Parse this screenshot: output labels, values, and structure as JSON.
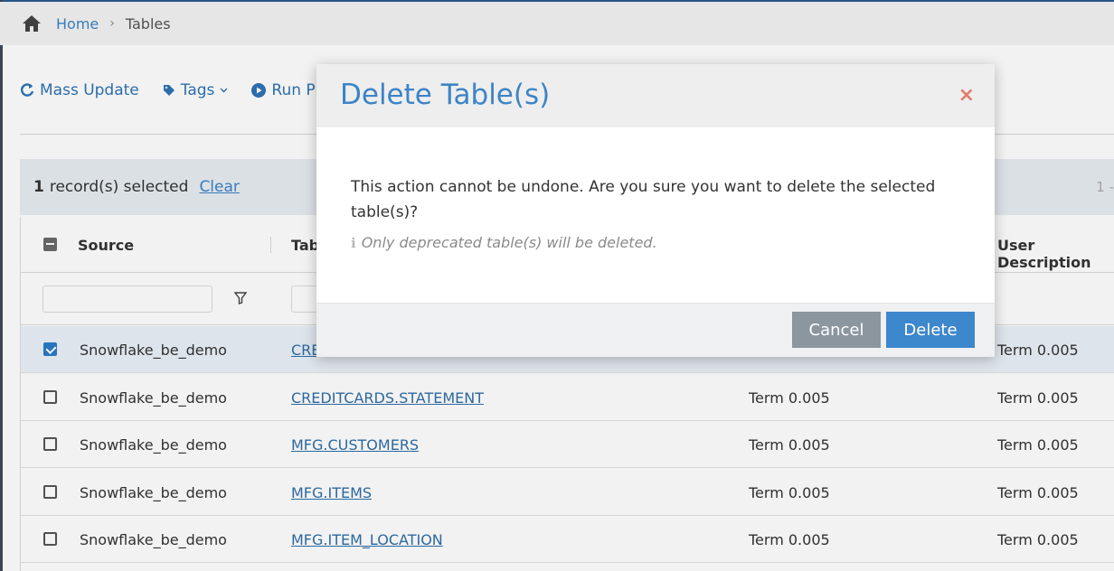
{
  "breadcrumb": {
    "home": "Home",
    "separator": "›",
    "current": "Tables"
  },
  "toolbar": {
    "mass_update": "Mass Update",
    "tags": "Tags",
    "run": "Run P"
  },
  "selection": {
    "count": "1",
    "label": "record(s) selected",
    "clear": "Clear",
    "pager": "1 -"
  },
  "grid": {
    "columns": {
      "source": "Source",
      "table": "Tab",
      "user_description": "User Description"
    },
    "rows": [
      {
        "source": "Snowflake_be_demo",
        "table": "CRE",
        "col3": "",
        "user_description": "Term 0.005",
        "selected": true
      },
      {
        "source": "Snowflake_be_demo",
        "table": "CREDITCARDS.STATEMENT",
        "col3": "Term 0.005",
        "user_description": "Term 0.005",
        "selected": false
      },
      {
        "source": "Snowflake_be_demo",
        "table": "MFG.CUSTOMERS",
        "col3": "Term 0.005",
        "user_description": "Term 0.005",
        "selected": false
      },
      {
        "source": "Snowflake_be_demo",
        "table": "MFG.ITEMS",
        "col3": "Term 0.005",
        "user_description": "Term 0.005",
        "selected": false
      },
      {
        "source": "Snowflake_be_demo",
        "table": "MFG.ITEM_LOCATION",
        "col3": "Term 0.005",
        "user_description": "Term 0.005",
        "selected": false
      }
    ]
  },
  "modal": {
    "title": "Delete Table(s)",
    "close": "×",
    "message": "This action cannot be undone. Are you sure you want to delete the selected table(s)?",
    "note": "Only deprecated table(s) will be deleted.",
    "cancel": "Cancel",
    "delete": "Delete"
  },
  "colors": {
    "accent": "#3c84c6",
    "close": "#e07c6b",
    "cancel_btn": "#8c969e",
    "delete_btn": "#3d87cc"
  }
}
